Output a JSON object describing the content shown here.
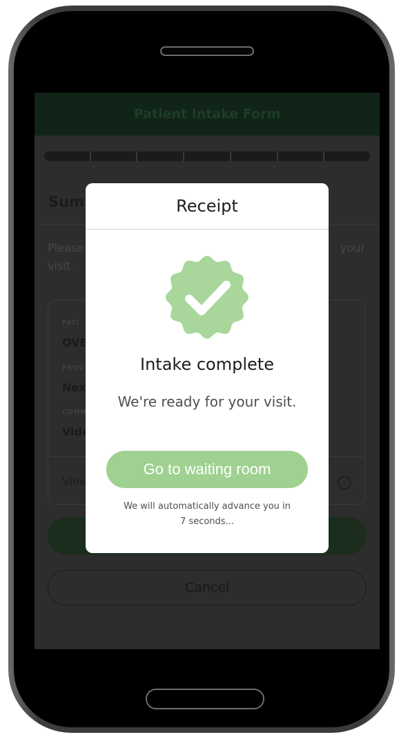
{
  "app": {
    "header_title": "Patient Intake Form",
    "progress_step_count": 7
  },
  "summary": {
    "title_partial": "Summ",
    "intro_start": "Please",
    "intro_end": "your",
    "intro_line2": "visit.",
    "fields": [
      {
        "label_partial": "PATI",
        "value_partial": "OVE"
      },
      {
        "label_partial": "PROV",
        "value_partial": "Next"
      },
      {
        "label_partial": "COMM",
        "value_partial": "Vide"
      }
    ],
    "view_link_partial": "View",
    "cancel_label": "Cancel"
  },
  "modal": {
    "title": "Receipt",
    "headline": "Intake complete",
    "subline": "We're ready for your visit.",
    "primary_button": "Go to waiting room",
    "note_line1": "We will automatically advance you in",
    "note_line2": "7 seconds..."
  },
  "colors": {
    "accent_green": "#9fd190",
    "modal_background": "#ffffff",
    "overlay": "#2d2d2d"
  },
  "icons": {
    "badge": "verified-check-badge-icon",
    "view_chevron": "chevron-right-circle-icon"
  }
}
